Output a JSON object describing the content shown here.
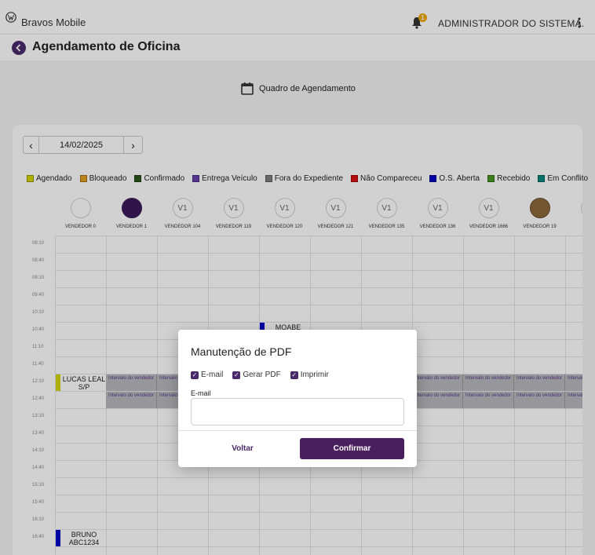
{
  "app": {
    "title": "Bravos Mobile",
    "notification_count": "1",
    "user": "ADMINISTRADOR DO SISTEMA."
  },
  "page": {
    "title": "Agendamento de Oficina",
    "section_title": "Quadro de Agendamento"
  },
  "date_nav": {
    "date": "14/02/2025",
    "prev": "‹",
    "next": "›"
  },
  "legend": [
    {
      "label": "Agendado",
      "color": "#d6d600"
    },
    {
      "label": "Bloqueado",
      "color": "#e3a020"
    },
    {
      "label": "Confirmado",
      "color": "#2d5a1e"
    },
    {
      "label": "Entrega Veículo",
      "color": "#6a3fb0"
    },
    {
      "label": "Fora do Expediente",
      "color": "#808080"
    },
    {
      "label": "Não Compareceu",
      "color": "#e01010"
    },
    {
      "label": "O.S. Aberta",
      "color": "#0000c8"
    },
    {
      "label": "Recebido",
      "color": "#4a9a20"
    },
    {
      "label": "Em Conflito",
      "color": "#0a8a80"
    }
  ],
  "vendors": [
    {
      "name": "VENDEDOR 0",
      "avatar": ""
    },
    {
      "name": "VENDEDOR 1",
      "avatar": ""
    },
    {
      "name": "VENDEDOR 104",
      "avatar": "V1"
    },
    {
      "name": "VENDEDOR 119",
      "avatar": "V1"
    },
    {
      "name": "VENDEDOR 120",
      "avatar": "V1"
    },
    {
      "name": "VENDEDOR 121",
      "avatar": "V1"
    },
    {
      "name": "VENDEDOR 135",
      "avatar": "V1"
    },
    {
      "name": "VENDEDOR 136",
      "avatar": "V1"
    },
    {
      "name": "VENDEDOR 1666",
      "avatar": "V1"
    },
    {
      "name": "VENDEDOR 19",
      "avatar": ""
    },
    {
      "name": "VEN",
      "avatar": ""
    }
  ],
  "times": [
    "08:10",
    "08:40",
    "09:10",
    "09:40",
    "10:10",
    "10:40",
    "11:10",
    "11:40",
    "12:10",
    "12:40",
    "13:10",
    "13:40",
    "14:10",
    "14:40",
    "15:10",
    "15:40",
    "16:10",
    "16:40"
  ],
  "interval_text": "Intervalo do vendedor",
  "appointments": {
    "moabe": "MOABE",
    "lucas": "LUCAS LEAL S/P",
    "bruno": "BRUNO ABC1234"
  },
  "modal": {
    "title": "Manutenção de PDF",
    "check_email": "E-mail",
    "check_pdf": "Gerar PDF",
    "check_print": "Imprimir",
    "email_label": "E-mail",
    "email_value": "",
    "back": "Voltar",
    "confirm": "Confirmar"
  }
}
